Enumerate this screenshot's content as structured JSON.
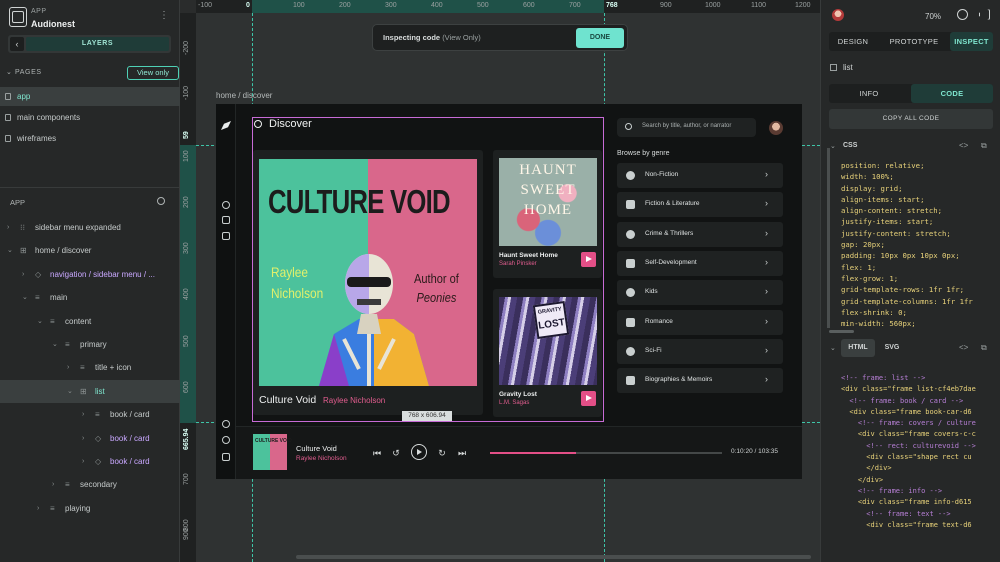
{
  "app": {
    "tag": "APP",
    "name": "Audionest"
  },
  "left_panel": {
    "layers_tab": "LAYERS",
    "pages_header": "PAGES",
    "view_only": "View only",
    "pages": [
      "app",
      "main components",
      "wireframes"
    ],
    "app_header": "APP",
    "tree": [
      {
        "label": "sidebar menu expanded",
        "indent": 1,
        "chev": "›",
        "icon": "⁝⁝",
        "style": ""
      },
      {
        "label": "home / discover",
        "indent": 1,
        "chev": "⌄",
        "icon": "⊞",
        "style": ""
      },
      {
        "label": "navigation / sidebar menu / ...",
        "indent": 2,
        "chev": "›",
        "icon": "◇",
        "style": "purple"
      },
      {
        "label": "main",
        "indent": 2,
        "chev": "⌄",
        "icon": "≡",
        "style": ""
      },
      {
        "label": "content",
        "indent": 3,
        "chev": "⌄",
        "icon": "≡",
        "style": ""
      },
      {
        "label": "primary",
        "indent": 4,
        "chev": "⌄",
        "icon": "≡",
        "style": ""
      },
      {
        "label": "title + icon",
        "indent": 5,
        "chev": "›",
        "icon": "≡",
        "style": ""
      },
      {
        "label": "list",
        "indent": 5,
        "chev": "⌄",
        "icon": "⊞",
        "style": "teal"
      },
      {
        "label": "book / card",
        "indent": 6,
        "chev": "›",
        "icon": "≡",
        "style": ""
      },
      {
        "label": "book / card",
        "indent": 6,
        "chev": "›",
        "icon": "◇",
        "style": "purple"
      },
      {
        "label": "book / card",
        "indent": 6,
        "chev": "›",
        "icon": "◇",
        "style": "purple"
      },
      {
        "label": "secondary",
        "indent": 4,
        "chev": "›",
        "icon": "≡",
        "style": ""
      },
      {
        "label": "playing",
        "indent": 3,
        "chev": "›",
        "icon": "≡",
        "style": ""
      }
    ]
  },
  "ruler": {
    "top": [
      "-100",
      "0",
      "100",
      "200",
      "300",
      "400",
      "500",
      "600",
      "700",
      "768",
      "900",
      "1000",
      "1100",
      "1200"
    ],
    "left": [
      "-200",
      "-100",
      "59",
      "100",
      "200",
      "300",
      "400",
      "500",
      "600",
      "665.94",
      "700",
      "800",
      "900"
    ]
  },
  "inspect_bar": {
    "title": "Inspecting code",
    "mode": "(View Only)",
    "done": "DONE"
  },
  "breadcrumb": "home / discover",
  "app_screen": {
    "title": "Discover",
    "search_placeholder": "Search by title, author, or narrator",
    "featured": {
      "cover_title": "CULTURE VOID",
      "cover_author_1": "Raylee",
      "cover_author_2": "Nicholson",
      "cover_of_1": "Author of",
      "cover_of_2": "Peonies",
      "title": "Culture Void",
      "author": "Raylee Nicholson"
    },
    "books": [
      {
        "title": "Haunt Sweet Home",
        "author": "Sarah Pinsker",
        "cover_text_1": "HAUNT",
        "cover_text_2": "SWEET",
        "cover_text_3": "HOME"
      },
      {
        "title": "Gravity Lost",
        "author": "L.M. Sagas",
        "cover_text_1": "GRAVITY",
        "cover_text_2": "LOST"
      }
    ],
    "genre_header": "Browse by genre",
    "genres": [
      "Non-Fiction",
      "Fiction & Literature",
      "Crime & Thrillers",
      "Self-Development",
      "Kids",
      "Romance",
      "Sci-Fi",
      "Biographies & Memoirs"
    ],
    "dimension_tag": "768 x 606.94",
    "player": {
      "title": "Culture Void",
      "author": "Raylee Nicholson",
      "cover_text": "CULTURE VOID",
      "time": "0:10:20 / 103:35",
      "progress": 0.37
    }
  },
  "right_panel": {
    "zoom": "70%",
    "mode_tabs": [
      "DESIGN",
      "PROTOTYPE",
      "INSPECT"
    ],
    "selected_name": "list",
    "info_tabs": [
      "INFO",
      "CODE"
    ],
    "copy_all": "COPY ALL CODE",
    "css_header": "CSS",
    "css_lines": [
      "position: relative;",
      "width: 100%;",
      "display: grid;",
      "align-items: start;",
      "align-content: stretch;",
      "justify-items: start;",
      "justify-content: stretch;",
      "gap: 20px;",
      "padding: 10px 0px 10px 0px;",
      "flex: 1;",
      "flex-grow: 1;",
      "grid-template-rows: 1fr 1fr;",
      "grid-template-columns: 1fr 1fr",
      "flex-shrink: 0;",
      "min-width: 560px;"
    ],
    "html_tabs": [
      "HTML",
      "SVG"
    ],
    "html_lines": [
      "<!-- frame: list -->",
      "<div class=\"frame list-cf4eb7dae",
      "  <!-- frame: book / card -->",
      "  <div class=\"frame book-car-d6",
      "    <!-- frame: covers / culture",
      "    <div class=\"frame covers-c-c",
      "      <!-- rect: culturevoid -->",
      "      <div class=\"shape rect cu",
      "      </div>",
      "    </div>",
      "    <!-- frame: info -->",
      "    <div class=\"frame info-d615",
      "      <!-- frame: text -->",
      "      <div class=\"frame text-d6"
    ]
  },
  "colors": {
    "accent": "#6fe3cf",
    "selection": "#c76bd6",
    "pink": "#e34f87"
  }
}
